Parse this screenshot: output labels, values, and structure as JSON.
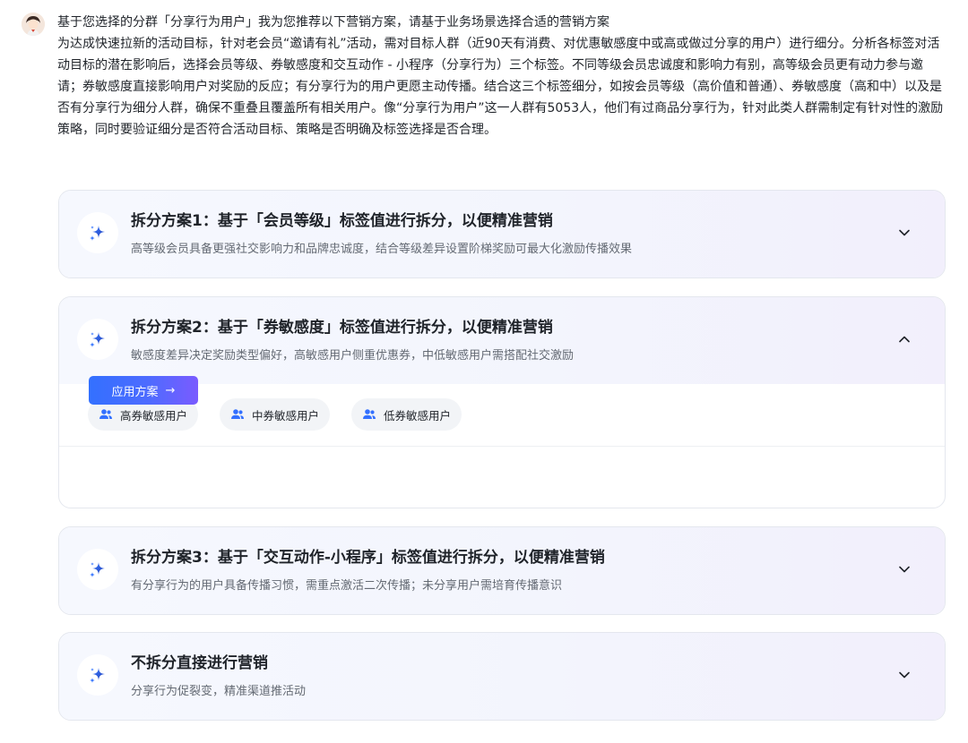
{
  "message": {
    "title": "基于您选择的分群「分享行为用户」我为您推荐以下营销方案，请基于业务场景选择合适的营销方案",
    "body": "为达成快速拉新的活动目标，针对老会员“邀请有礼”活动，需对目标人群（近90天有消费、对优惠敏感度中或高或做过分享的用户）进行细分。分析各标签对活动目标的潜在影响后，选择会员等级、券敏感度和交互动作 - 小程序（分享行为）三个标签。不同等级会员忠诚度和影响力有别，高等级会员更有动力参与邀请；券敏感度直接影响用户对奖励的反应；有分享行为的用户更愿主动传播。结合这三个标签细分，如按会员等级（高价值和普通）、券敏感度（高和中）以及是否有分享行为细分人群，确保不重叠且覆盖所有相关用户。像“分享行为用户”这一人群有5053人，他们有过商品分享行为，针对此类人群需制定有针对性的激励策略，同时要验证细分是否符合活动目标、策略是否明确及标签选择是否合理。"
  },
  "plans": [
    {
      "title": "拆分方案1：基于「会员等级」标签值进行拆分，以便精准营销",
      "desc": "高等级会员具备更强社交影响力和品牌忠诚度，结合等级差异设置阶梯奖励可最大化激励传播效果",
      "expanded": false
    },
    {
      "title": "拆分方案2：基于「券敏感度」标签值进行拆分，以便精准营销",
      "desc": "敏感度差异决定奖励类型偏好，高敏感用户侧重优惠券，中低敏感用户需搭配社交激励",
      "expanded": true,
      "tags": [
        "高券敏感用户",
        "中券敏感用户",
        "低券敏感用户"
      ],
      "apply_label": "应用方案"
    },
    {
      "title": "拆分方案3：基于「交互动作-小程序」标签值进行拆分，以便精准营销",
      "desc": "有分享行为的用户具备传播习惯，需重点激活二次传播；未分享用户需培育传播意识",
      "expanded": false
    },
    {
      "title": "不拆分直接进行营销",
      "desc": "分享行为促裂变，精准渠道推活动",
      "expanded": false
    }
  ],
  "colors": {
    "accent": "#3370ff",
    "text": "#1f2329",
    "muted": "#646a73"
  },
  "icons": {
    "plan_icon": "sparkle-icon",
    "collapsed": "chevron-down-icon",
    "expanded": "chevron-up-icon",
    "tag_icon": "user-group-icon",
    "apply_icon": "arrow-right-icon"
  }
}
